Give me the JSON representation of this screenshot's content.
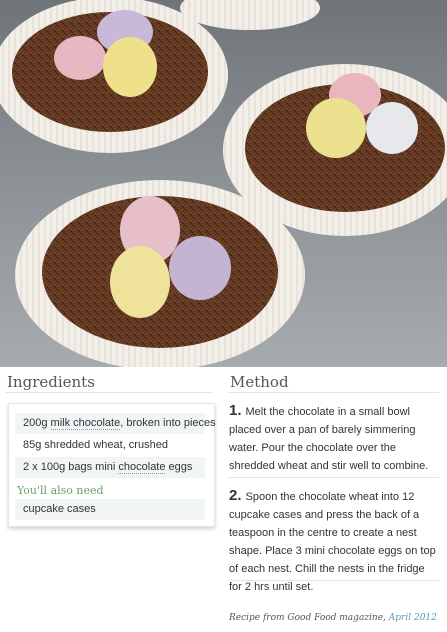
{
  "ingredients": {
    "heading": "Ingredients",
    "items": [
      {
        "before": "200g ",
        "link": "milk chocolate",
        "after": ", broken into pieces"
      },
      {
        "before": "85g shredded wheat, crushed",
        "link": "",
        "after": ""
      },
      {
        "before": "2 x 100g bags mini ",
        "link": "chocolate",
        "after": " eggs"
      }
    ],
    "also_label": "You'll also need",
    "also_items": [
      "cupcake cases"
    ]
  },
  "method": {
    "heading": "Method",
    "steps": [
      {
        "number": "1.",
        "text": "Melt the chocolate in a small bowl placed over a pan of barely simmering water. Pour the chocolate over the shredded wheat and stir well to combine."
      },
      {
        "number": "2.",
        "text": "Spoon the chocolate wheat into 12 cupcake cases and press the back of a teaspoon in the centre to create a nest shape. Place 3 mini chocolate eggs on top of each nest. Chill the nests in the fridge for 2 hrs until set."
      }
    ]
  },
  "credit": {
    "prefix": "Recipe from Good Food magazine, ",
    "link": "April 2012"
  },
  "colors": {
    "link": "#5a9ab5",
    "also_label": "#6aa36a",
    "row_bg": "#f1f5f6"
  }
}
